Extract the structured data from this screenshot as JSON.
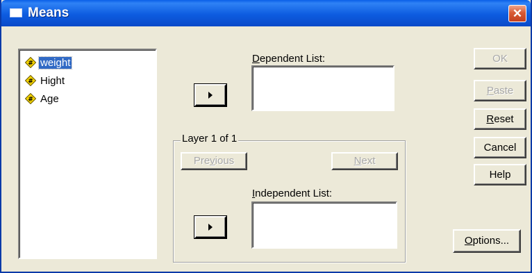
{
  "window": {
    "title": "Means",
    "close_glyph": "✕"
  },
  "variables": [
    {
      "label": "weight",
      "icon": "numeric-scale-icon",
      "selected": true
    },
    {
      "label": "Hight",
      "icon": "numeric-scale-icon",
      "selected": false
    },
    {
      "label": "Age",
      "icon": "numeric-scale-icon",
      "selected": false
    }
  ],
  "dependent": {
    "label_mn": "D",
    "label_rest": "ependent List:"
  },
  "layer": {
    "label": "Layer 1 of 1",
    "previous_pre": "Pre",
    "previous_mn": "v",
    "previous_post": "ious",
    "next_mn": "N",
    "next_rest": "ext"
  },
  "independent": {
    "label_mn": "I",
    "label_rest": "ndependent List:"
  },
  "buttons": {
    "ok": "OK",
    "paste_mn": "P",
    "paste_rest": "aste",
    "reset_mn": "R",
    "reset_rest": "eset",
    "cancel": "Cancel",
    "help": "Help",
    "options_mn": "O",
    "options_rest": "ptions..."
  }
}
